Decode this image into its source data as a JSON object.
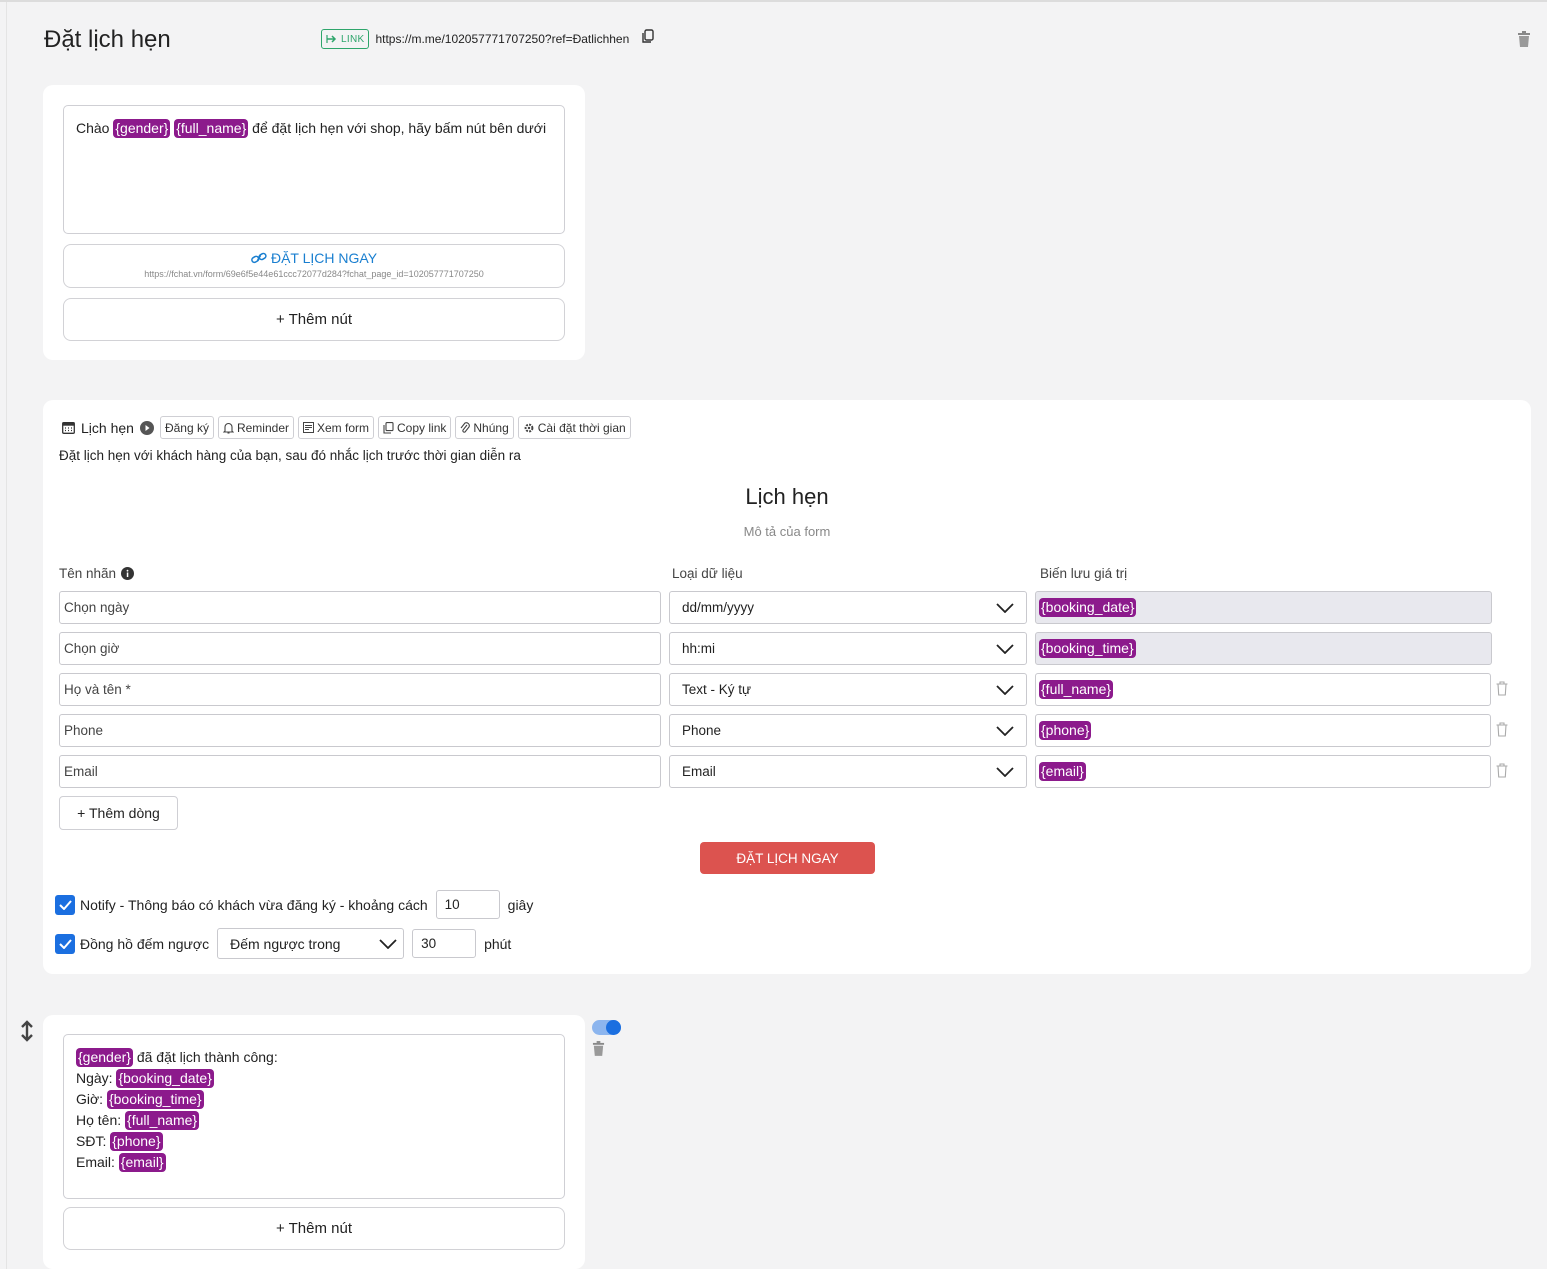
{
  "header": {
    "title": "Đặt lịch hẹn",
    "link_badge": "LINK",
    "link_url": "https://m.me/102057771707250?ref=Đatlichhen"
  },
  "welcome": {
    "text_prefix": "Chào ",
    "tag_gender": "{gender}",
    "tag_full_name": "{full_name}",
    "text_suffix": " để đặt lịch hẹn với shop, hãy bấm nút bên dưới",
    "button_label": "ĐẶT LỊCH NGAY",
    "button_url": "https://fchat.vn/form/69e6f5e44e61ccc72077d284?fchat_page_id=102057771707250",
    "add_button": "+ Thêm nút"
  },
  "booking": {
    "title": "Lịch hẹn",
    "toolbar": [
      "Đăng ký",
      "Reminder",
      "Xem form",
      "Copy link",
      "Nhúng",
      "Cài đặt thời gian"
    ],
    "description": "Đặt lịch hẹn với khách hàng của bạn, sau đó nhắc lịch trước thời gian diễn ra",
    "form_title": "Lịch hẹn",
    "form_description": "Mô tả của form",
    "columns": {
      "label": "Tên nhãn",
      "type": "Loại dữ liệu",
      "variable": "Biến lưu giá trị"
    },
    "rows": [
      {
        "label": "Chọn ngày",
        "type": "dd/mm/yyyy",
        "variable": "{booking_date}",
        "readonly": true
      },
      {
        "label": "Chọn giờ",
        "type": "hh:mi",
        "variable": "{booking_time}",
        "readonly": true
      },
      {
        "label": "Họ và tên *",
        "type": "Text - Ký tự",
        "variable": "{full_name}",
        "readonly": false
      },
      {
        "label": "Phone",
        "type": "Phone",
        "variable": "{phone}",
        "readonly": false
      },
      {
        "label": "Email",
        "type": "Email",
        "variable": "{email}",
        "readonly": false
      }
    ],
    "add_row": "+ Thêm dòng",
    "submit": "ĐẶT LỊCH NGAY",
    "notify": {
      "checked": true,
      "label": "Notify - Thông báo có khách vừa đăng ký - khoảng cách",
      "value": "10",
      "unit": "giây"
    },
    "countdown": {
      "checked": true,
      "label": "Đồng hồ đếm ngược",
      "mode": "Đếm ngược trong",
      "value": "30",
      "unit": "phút"
    }
  },
  "confirmation": {
    "lines": [
      {
        "prefix": "",
        "tag": "{gender}",
        "suffix": " đã đặt lịch thành công:"
      },
      {
        "prefix": "Ngày: ",
        "tag": "{booking_date}",
        "suffix": ""
      },
      {
        "prefix": "Giờ: ",
        "tag": "{booking_time}",
        "suffix": ""
      },
      {
        "prefix": "Họ tên: ",
        "tag": "{full_name}",
        "suffix": ""
      },
      {
        "prefix": "SĐT: ",
        "tag": "{phone}",
        "suffix": ""
      },
      {
        "prefix": "Email: ",
        "tag": "{email}",
        "suffix": ""
      }
    ],
    "add_button": "+ Thêm nút",
    "enabled": true
  },
  "colors": {
    "tag_bg": "#8c1a8c",
    "cta_bg": "#dc534f",
    "link_green": "#2ea56b",
    "link_blue": "#1a7fd0",
    "check_blue": "#1b6fe0"
  }
}
